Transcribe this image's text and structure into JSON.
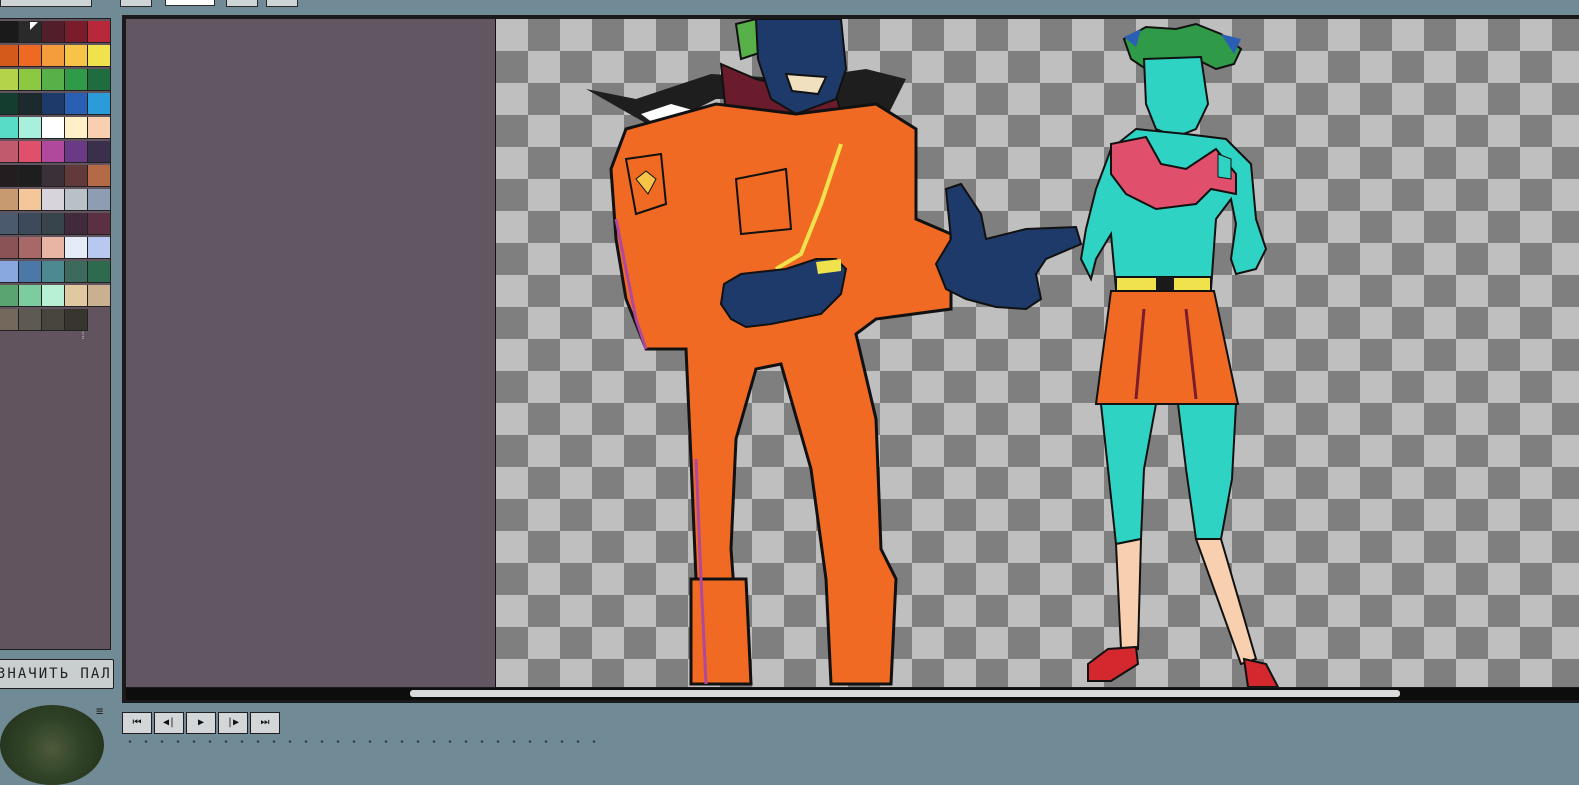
{
  "palette": {
    "colors": [
      "#1a1a1a",
      "#2a2a2a",
      "#521e2a",
      "#7a1c2c",
      "#b7283a",
      "#d45a1c",
      "#ee6a24",
      "#f59c3c",
      "#f7c448",
      "#f0e24c",
      "#b4d24a",
      "#8cc840",
      "#58b048",
      "#2f9a48",
      "#1f6c3e",
      "#153d2f",
      "#1c2a2e",
      "#1e3a6a",
      "#2b5fb4",
      "#2c9cd8",
      "#58dcc8",
      "#a8f0dc",
      "#ffffff",
      "#fff0c8",
      "#f8d0b0",
      "#c05a6c",
      "#e0506c",
      "#b0489c",
      "#6a3a86",
      "#3a304c",
      "#231d20",
      "#1e1e1e",
      "#3a3038",
      "#623a3c",
      "#b46a46",
      "#c89a70",
      "#f4c79a",
      "#d8d4dc",
      "#b8c0c8",
      "#8e9cb4",
      "#4c5a6e",
      "#3c4a5a",
      "#38444c",
      "#402a3c",
      "#5a3042",
      "#8a5456",
      "#a86868",
      "#e8b4a4",
      "#e4ecf8",
      "#b8c8f0",
      "#8aa8e0",
      "#4c78a8",
      "#4c8a90",
      "#3c6a5c",
      "#2e6a4e",
      "#5aa470",
      "#7ccca0",
      "#b8f0d4",
      "#e0c8a0",
      "#c8b090",
      "#74685c",
      "#5e5a52",
      "#48443e",
      "#38342e"
    ],
    "marker_icon": "selected-swatch-marker"
  },
  "palette_button": {
    "label": "ЗНАЧИТЬ ПАЛЕ"
  },
  "playback": {
    "first": "⏮",
    "prev": "◀|",
    "play": "▶",
    "next": "|▶",
    "last": "⏭"
  },
  "colors": {
    "workspace_bg": "#625662",
    "panel_bg": "#708b96",
    "checker_dark": "#7f7f7f",
    "checker_light": "#bfbfbf"
  }
}
